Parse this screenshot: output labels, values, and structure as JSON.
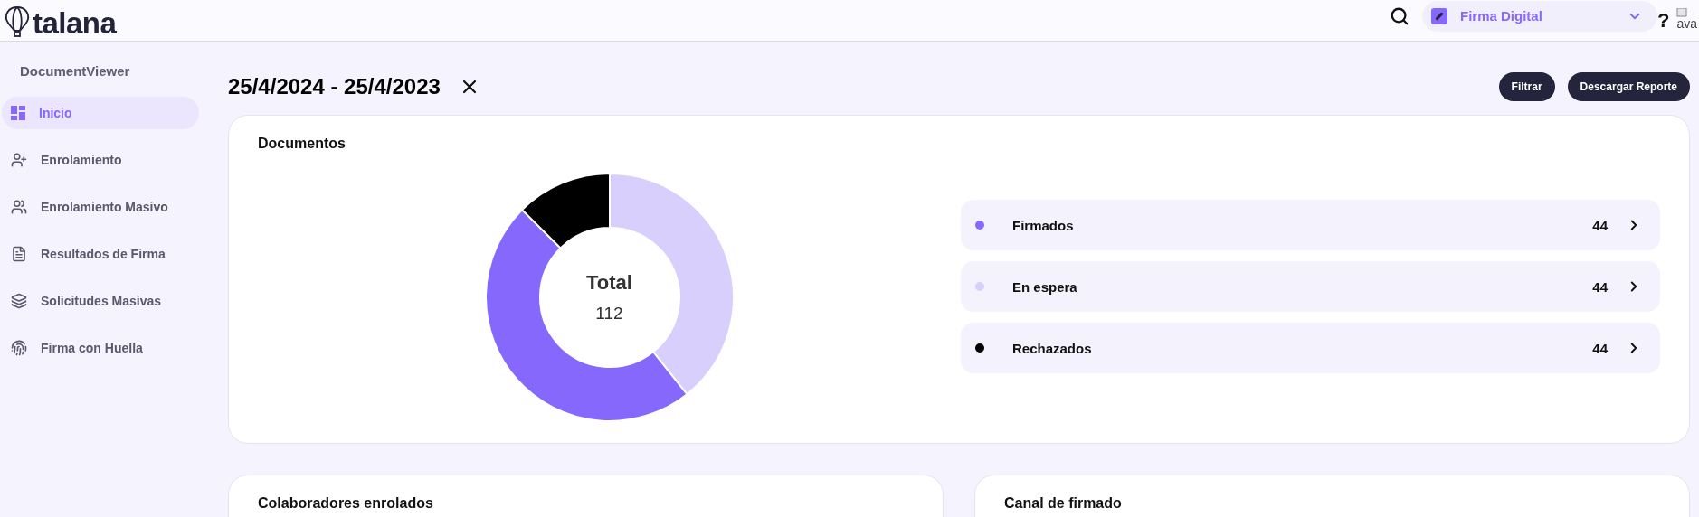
{
  "header": {
    "logo": "talana",
    "product_selector": {
      "label": "Firma Digital"
    },
    "help": "?",
    "avatar_alt": "ava"
  },
  "sidebar": {
    "title": "DocumentViewer",
    "items": [
      {
        "label": "Inicio",
        "kind": "dashboard",
        "selected": true
      },
      {
        "label": "Enrolamiento",
        "kind": "user-add",
        "selected": false
      },
      {
        "label": "Enrolamiento Masivo",
        "kind": "group-add",
        "selected": false
      },
      {
        "label": "Resultados de Firma",
        "kind": "document",
        "selected": false
      },
      {
        "label": "Solicitudes Masivas",
        "kind": "layers",
        "selected": false
      },
      {
        "label": "Firma con Huella",
        "kind": "fingerprint",
        "selected": false
      }
    ]
  },
  "page": {
    "date_range": "25/4/2024 - 25/4/2023",
    "buttons": [
      "Filtrar",
      "Descargar Reporte"
    ]
  },
  "documents_card": {
    "title": "Documentos",
    "center_label": "Total",
    "center_value": "112",
    "chart_data": {
      "type": "donut",
      "values": [
        39.3,
        48.2,
        12.5
      ],
      "colors": [
        "#d8cffd",
        "#8768fd",
        "#000000"
      ]
    },
    "legend": [
      {
        "label": "Firmados",
        "value": "44",
        "color": "#8768fd"
      },
      {
        "label": "En espera",
        "value": "44",
        "color": "#d8cffd"
      },
      {
        "label": "Rechazados",
        "value": "44",
        "color": "#000000"
      }
    ]
  },
  "bottom_cards": [
    {
      "title": "Colaboradores enrolados"
    },
    {
      "title": "Canal de firmado"
    }
  ]
}
